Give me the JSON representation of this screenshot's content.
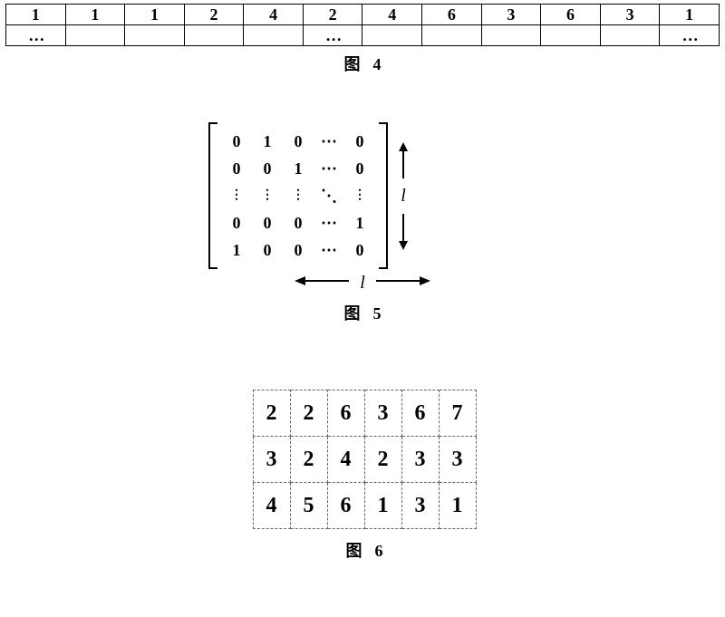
{
  "fig4": {
    "row1": [
      "1",
      "1",
      "1",
      "2",
      "4",
      "2",
      "4",
      "6",
      "3",
      "6",
      "3",
      "1"
    ],
    "row2": [
      "…",
      "",
      "",
      "",
      "",
      "…",
      "",
      "",
      "",
      "",
      "",
      "…"
    ],
    "caption_prefix": "图",
    "caption_number": "4"
  },
  "fig5": {
    "matrix": [
      [
        "0",
        "1",
        "0",
        "⋯",
        "0"
      ],
      [
        "0",
        "0",
        "1",
        "⋯",
        "0"
      ],
      [
        "⋮",
        "⋮",
        "⋮",
        "⋱",
        "⋮"
      ],
      [
        "0",
        "0",
        "0",
        "⋯",
        "1"
      ],
      [
        "1",
        "0",
        "0",
        "⋯",
        "0"
      ]
    ],
    "side_label": "l",
    "bottom_label": "l",
    "caption_prefix": "图",
    "caption_number": "5"
  },
  "fig6": {
    "grid": [
      [
        "2",
        "2",
        "6",
        "3",
        "6",
        "7"
      ],
      [
        "3",
        "2",
        "4",
        "2",
        "3",
        "3"
      ],
      [
        "4",
        "5",
        "6",
        "1",
        "3",
        "1"
      ]
    ],
    "caption_prefix": "图",
    "caption_number": "6"
  },
  "chart_data": [
    {
      "type": "table",
      "title": "图 4",
      "rows": [
        [
          "1",
          "1",
          "1",
          "2",
          "4",
          "2",
          "4",
          "6",
          "3",
          "6",
          "3",
          "1"
        ],
        [
          "…",
          "",
          "",
          "",
          "",
          "…",
          "",
          "",
          "",
          "",
          "",
          "…"
        ]
      ]
    },
    {
      "type": "table",
      "title": "图 5 (l × l cyclic shift matrix)",
      "rows": [
        [
          "0",
          "1",
          "0",
          "⋯",
          "0"
        ],
        [
          "0",
          "0",
          "1",
          "⋯",
          "0"
        ],
        [
          "⋮",
          "⋮",
          "⋮",
          "⋱",
          "⋮"
        ],
        [
          "0",
          "0",
          "0",
          "⋯",
          "1"
        ],
        [
          "1",
          "0",
          "0",
          "⋯",
          "0"
        ]
      ],
      "row_count_label": "l",
      "col_count_label": "l"
    },
    {
      "type": "table",
      "title": "图 6",
      "rows": [
        [
          2,
          2,
          6,
          3,
          6,
          7
        ],
        [
          3,
          2,
          4,
          2,
          3,
          3
        ],
        [
          4,
          5,
          6,
          1,
          3,
          1
        ]
      ]
    }
  ]
}
